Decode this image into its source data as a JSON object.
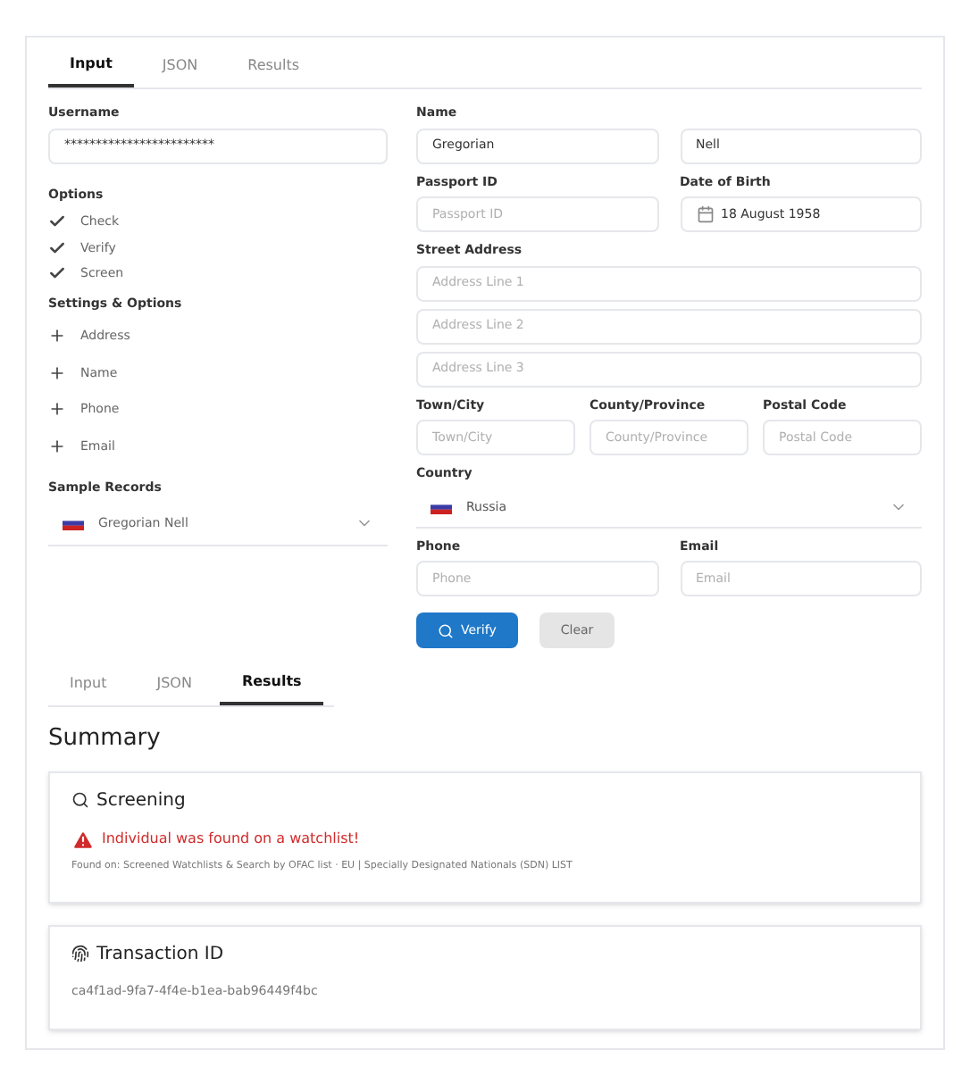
{
  "tabs": [
    {
      "label": "Input",
      "selected": true
    },
    {
      "label": "JSON",
      "selected": false
    },
    {
      "label": "Results",
      "selected": false
    }
  ],
  "username": {
    "label": "Username",
    "value": "************************"
  },
  "options": {
    "label": "Options",
    "items": [
      {
        "label": "Check",
        "checked": true
      },
      {
        "label": "Verify",
        "checked": true
      },
      {
        "label": "Screen",
        "checked": true
      }
    ]
  },
  "settings": {
    "label": "Settings & Options",
    "items": [
      {
        "label": "Address",
        "checked": false
      },
      {
        "label": "Name",
        "checked": false
      },
      {
        "label": "Phone",
        "checked": false
      },
      {
        "label": "Email",
        "checked": false
      }
    ]
  },
  "sample_records": {
    "label": "Sample Records",
    "value": "Gregorian Nell"
  },
  "name": {
    "label": "Name",
    "first": "Gregorian",
    "last": "Nell"
  },
  "passport": {
    "label": "Passport ID",
    "placeholder": "Passport ID"
  },
  "dob": {
    "label": "Date of Birth",
    "value": "18 August 1958"
  },
  "street": {
    "label": "Street Address",
    "placeholders": [
      "Address Line 1",
      "Address Line 2",
      "Address Line 3"
    ]
  },
  "locality": [
    {
      "label": "Town/City",
      "placeholder": "Town/City"
    },
    {
      "label": "County/Province",
      "placeholder": "County/Province"
    },
    {
      "label": "Postal Code",
      "placeholder": "Postal Code"
    }
  ],
  "country": {
    "label": "Country",
    "value": "Russia"
  },
  "contact": [
    {
      "label": "Phone",
      "placeholder": "Phone"
    },
    {
      "label": "Email",
      "placeholder": "Email"
    }
  ],
  "buttons": {
    "verify": "Verify",
    "clear": "Clear"
  },
  "result_tabs": [
    {
      "label": "Input",
      "selected": false
    },
    {
      "label": "JSON",
      "selected": false
    },
    {
      "label": "Results",
      "selected": true
    }
  ],
  "summary": {
    "title": "Summary"
  },
  "screening": {
    "title": "Screening",
    "alert": "Individual was found on a watchlist!",
    "detail": "Found on: Screened Watchlists & Search by OFAC list · EU | Specially Designated Nationals (SDN) LIST"
  },
  "transaction": {
    "title": "Transaction ID",
    "value": "ca4f1ad-9fa7-4f4e-b1ea-bab96449f4bc"
  }
}
